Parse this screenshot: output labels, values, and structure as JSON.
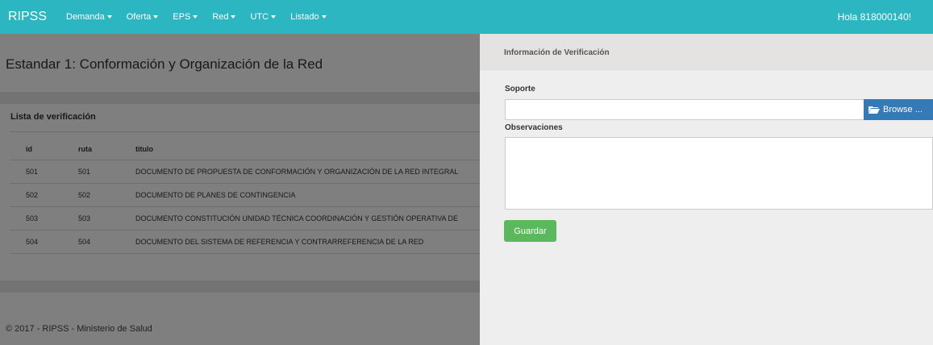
{
  "navbar": {
    "brand": "RIPSS",
    "menu": [
      {
        "label": "Demanda"
      },
      {
        "label": "Oferta"
      },
      {
        "label": "EPS"
      },
      {
        "label": "Red"
      },
      {
        "label": "UTC"
      },
      {
        "label": "Listado"
      }
    ],
    "greeting": "Hola 818000140!",
    "color": "#2bb6c1"
  },
  "main": {
    "page_title": "Estandar 1: Conformación y Organización de la Red",
    "panel_title": "Lista de verificación",
    "table": {
      "columns": [
        "id",
        "ruta",
        "titulo"
      ],
      "rows": [
        [
          "501",
          "501",
          "DOCUMENTO DE PROPUESTA DE CONFORMACIÓN Y ORGANIZACIÓN DE LA RED INTEGRAL"
        ],
        [
          "502",
          "502",
          "DOCUMENTO DE PLANES DE CONTINGENCIA"
        ],
        [
          "503",
          "503",
          "DOCUMENTO CONSTITUCIÓN UNIDAD TÉCNICA COORDINACIÓN Y GESTIÓN OPERATIVA DE"
        ],
        [
          "504",
          "504",
          "DOCUMENTO DEL SISTEMA DE REFERENCIA Y CONTRARREFERENCIA DE LA RED"
        ]
      ]
    },
    "footer": "© 2017 - RIPSS - Ministerio de Salud"
  },
  "side_panel": {
    "title": "Información de Verificación",
    "soporte_label": "Soporte",
    "file_value": "",
    "browse_label": "Browse ...",
    "browse_icon": "folder-open-icon",
    "observaciones_label": "Observaciones",
    "observaciones_value": "",
    "save_label": "Guardar",
    "browse_color": "#337ab7",
    "save_color": "#5cb85c"
  }
}
